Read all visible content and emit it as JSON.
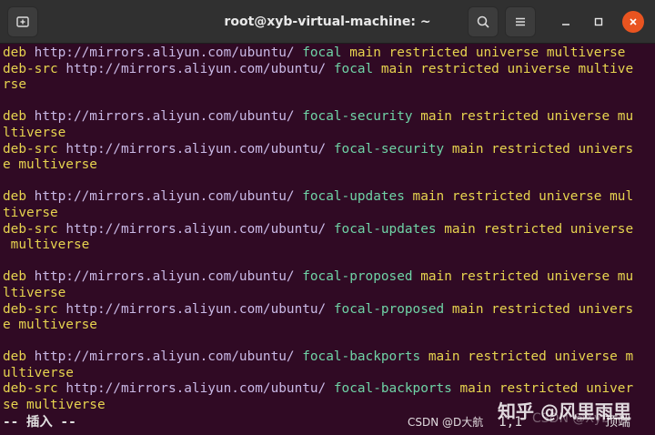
{
  "window": {
    "title": "root@xyb-virtual-machine: ~",
    "colors": {
      "titlebar": "#303030",
      "background": "#300a24",
      "close": "#e95420"
    }
  },
  "titlebar": {
    "new_tab_icon": "new-tab-icon",
    "search_icon": "search-icon",
    "menu_icon": "hamburger-menu-icon",
    "minimize_icon": "minimize-icon",
    "maximize_icon": "maximize-icon",
    "close_icon": "close-icon"
  },
  "terminal": {
    "lines": [
      [
        [
          "deb ",
          "kw"
        ],
        [
          "http://mirrors.aliyun.com/ubuntu/ ",
          "url"
        ],
        [
          "focal ",
          "dist"
        ],
        [
          "main restricted universe multiverse",
          "comp"
        ]
      ],
      [
        [
          "deb-src ",
          "kw"
        ],
        [
          "http://mirrors.aliyun.com/ubuntu/ ",
          "url"
        ],
        [
          "focal ",
          "dist"
        ],
        [
          "main restricted universe multive",
          "comp"
        ]
      ],
      [
        [
          "rse",
          "comp"
        ]
      ],
      [
        [
          "",
          "plain"
        ]
      ],
      [
        [
          "deb ",
          "kw"
        ],
        [
          "http://mirrors.aliyun.com/ubuntu/ ",
          "url"
        ],
        [
          "focal-security ",
          "dist"
        ],
        [
          "main restricted universe mu",
          "comp"
        ]
      ],
      [
        [
          "ltiverse",
          "comp"
        ]
      ],
      [
        [
          "deb-src ",
          "kw"
        ],
        [
          "http://mirrors.aliyun.com/ubuntu/ ",
          "url"
        ],
        [
          "focal-security ",
          "dist"
        ],
        [
          "main restricted univers",
          "comp"
        ]
      ],
      [
        [
          "e multiverse",
          "comp"
        ]
      ],
      [
        [
          "",
          "plain"
        ]
      ],
      [
        [
          "deb ",
          "kw"
        ],
        [
          "http://mirrors.aliyun.com/ubuntu/ ",
          "url"
        ],
        [
          "focal-updates ",
          "dist"
        ],
        [
          "main restricted universe mul",
          "comp"
        ]
      ],
      [
        [
          "tiverse",
          "comp"
        ]
      ],
      [
        [
          "deb-src ",
          "kw"
        ],
        [
          "http://mirrors.aliyun.com/ubuntu/ ",
          "url"
        ],
        [
          "focal-updates ",
          "dist"
        ],
        [
          "main restricted universe",
          "comp"
        ]
      ],
      [
        [
          " multiverse",
          "comp"
        ]
      ],
      [
        [
          "",
          "plain"
        ]
      ],
      [
        [
          "deb ",
          "kw"
        ],
        [
          "http://mirrors.aliyun.com/ubuntu/ ",
          "url"
        ],
        [
          "focal-proposed ",
          "dist"
        ],
        [
          "main restricted universe mu",
          "comp"
        ]
      ],
      [
        [
          "ltiverse",
          "comp"
        ]
      ],
      [
        [
          "deb-src ",
          "kw"
        ],
        [
          "http://mirrors.aliyun.com/ubuntu/ ",
          "url"
        ],
        [
          "focal-proposed ",
          "dist"
        ],
        [
          "main restricted univers",
          "comp"
        ]
      ],
      [
        [
          "e multiverse",
          "comp"
        ]
      ],
      [
        [
          "",
          "plain"
        ]
      ],
      [
        [
          "deb ",
          "kw"
        ],
        [
          "http://mirrors.aliyun.com/ubuntu/ ",
          "url"
        ],
        [
          "focal-backports ",
          "dist"
        ],
        [
          "main restricted universe m",
          "comp"
        ]
      ],
      [
        [
          "ultiverse",
          "comp"
        ]
      ],
      [
        [
          "deb-src ",
          "kw"
        ],
        [
          "http://mirrors.aliyun.com/ubuntu/ ",
          "url"
        ],
        [
          "focal-backports ",
          "dist"
        ],
        [
          "main restricted univer",
          "comp"
        ]
      ],
      [
        [
          "se multiverse",
          "comp"
        ]
      ]
    ],
    "status_mode": "-- 插入 --",
    "cursor_position": "1,1",
    "scroll_position": "顶端"
  },
  "watermarks": {
    "zhihu": "知乎 @风里雨里",
    "csdn": "CSDN @D大航",
    "csdn_faint": "CSDN @Xyb"
  }
}
